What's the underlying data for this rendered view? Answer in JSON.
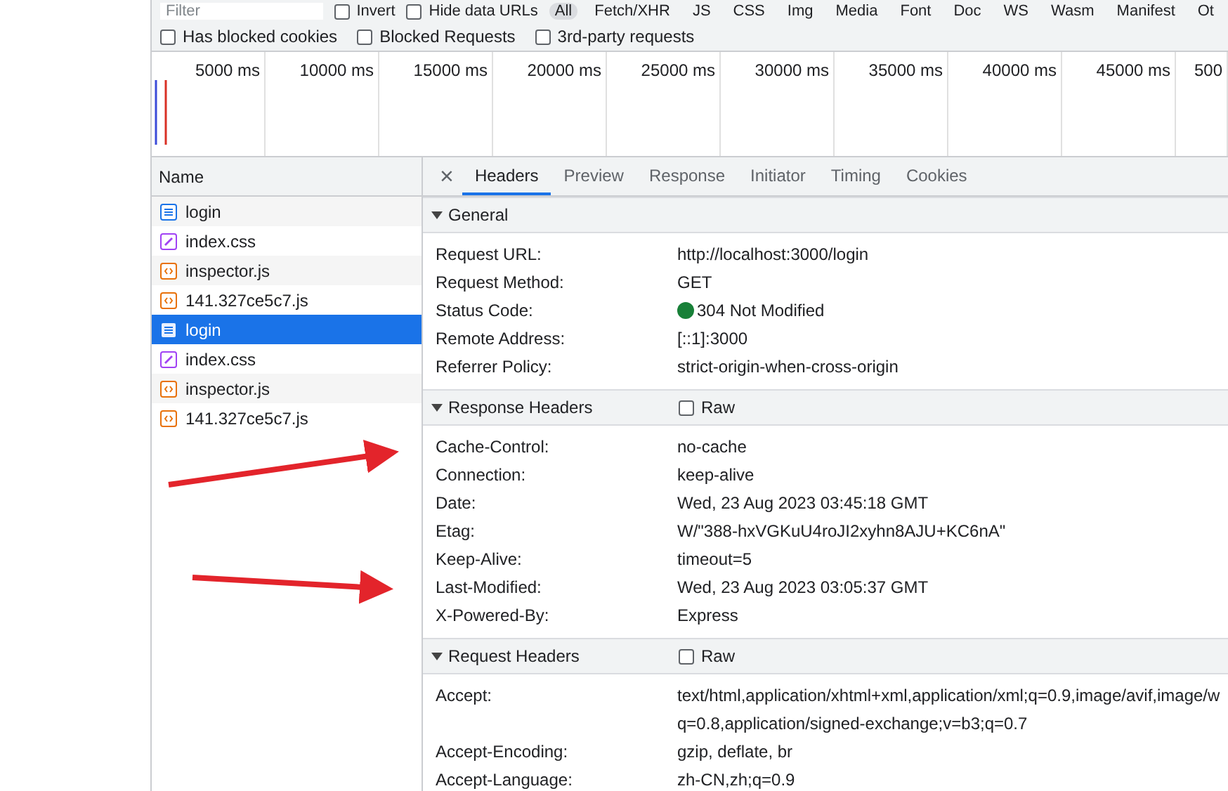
{
  "filter_bar": {
    "placeholder": "Filter",
    "checkboxes": [
      {
        "label": "Invert",
        "checked": false
      },
      {
        "label": "Hide data URLs",
        "checked": false
      }
    ],
    "type_filters": [
      {
        "label": "All",
        "selected": true
      },
      {
        "label": "Fetch/XHR",
        "selected": false
      },
      {
        "label": "JS",
        "selected": false
      },
      {
        "label": "CSS",
        "selected": false
      },
      {
        "label": "Img",
        "selected": false
      },
      {
        "label": "Media",
        "selected": false
      },
      {
        "label": "Font",
        "selected": false
      },
      {
        "label": "Doc",
        "selected": false
      },
      {
        "label": "WS",
        "selected": false
      },
      {
        "label": "Wasm",
        "selected": false
      },
      {
        "label": "Manifest",
        "selected": false
      },
      {
        "label": "Ot",
        "selected": false
      }
    ]
  },
  "options": [
    {
      "label": "Has blocked cookies",
      "checked": false
    },
    {
      "label": "Blocked Requests",
      "checked": false
    },
    {
      "label": "3rd-party requests",
      "checked": false
    }
  ],
  "timeline": {
    "ticks": [
      "5000 ms",
      "10000 ms",
      "15000 ms",
      "20000 ms",
      "25000 ms",
      "30000 ms",
      "35000 ms",
      "40000 ms",
      "45000 ms",
      "500"
    ]
  },
  "requests": {
    "column": "Name",
    "items": [
      {
        "name": "login",
        "kind": "document",
        "selected": false
      },
      {
        "name": "index.css",
        "kind": "stylesheet",
        "selected": false
      },
      {
        "name": "inspector.js",
        "kind": "script",
        "selected": false
      },
      {
        "name": "141.327ce5c7.js",
        "kind": "script",
        "selected": false
      },
      {
        "name": "login",
        "kind": "document",
        "selected": true
      },
      {
        "name": "index.css",
        "kind": "stylesheet",
        "selected": false
      },
      {
        "name": "inspector.js",
        "kind": "script",
        "selected": false
      },
      {
        "name": "141.327ce5c7.js",
        "kind": "script",
        "selected": false
      }
    ]
  },
  "details": {
    "close": "×",
    "tabs": [
      {
        "label": "Headers",
        "selected": true
      },
      {
        "label": "Preview",
        "selected": false
      },
      {
        "label": "Response",
        "selected": false
      },
      {
        "label": "Initiator",
        "selected": false
      },
      {
        "label": "Timing",
        "selected": false
      },
      {
        "label": "Cookies",
        "selected": false
      }
    ],
    "sections": [
      {
        "title": "General",
        "expanded": true,
        "rows": [
          {
            "name": "Request URL:",
            "value": "http://localhost:3000/login"
          },
          {
            "name": "Request Method:",
            "value": "GET"
          },
          {
            "name": "Status Code:",
            "value": "304 Not Modified",
            "kind": "status",
            "color": "#188038"
          },
          {
            "name": "Remote Address:",
            "value": "[::1]:3000"
          },
          {
            "name": "Referrer Policy:",
            "value": "strict-origin-when-cross-origin"
          }
        ]
      },
      {
        "title": "Response Headers",
        "expanded": true,
        "raw": {
          "label": "Raw",
          "checked": false
        },
        "rows": [
          {
            "name": "Cache-Control:",
            "value": "no-cache"
          },
          {
            "name": "Connection:",
            "value": "keep-alive"
          },
          {
            "name": "Date:",
            "value": "Wed, 23 Aug 2023 03:45:18 GMT"
          },
          {
            "name": "Etag:",
            "value": "W/\"388-hxVGKuU4roJI2xyhn8AJU+KC6nA\""
          },
          {
            "name": "Keep-Alive:",
            "value": "timeout=5"
          },
          {
            "name": "Last-Modified:",
            "value": "Wed, 23 Aug 2023 03:05:37 GMT"
          },
          {
            "name": "X-Powered-By:",
            "value": "Express"
          }
        ]
      },
      {
        "title": "Request Headers",
        "expanded": true,
        "raw": {
          "label": "Raw",
          "checked": false
        },
        "rows": [
          {
            "name": "Accept:",
            "value": "text/html,application/xhtml+xml,application/xml;q=0.9,image/avif,image/w q=0.8,application/signed-exchange;v=b3;q=0.7"
          },
          {
            "name": "Accept-Encoding:",
            "value": "gzip, deflate, br"
          },
          {
            "name": "Accept-Language:",
            "value": "zh-CN,zh;q=0.9"
          }
        ]
      }
    ]
  }
}
